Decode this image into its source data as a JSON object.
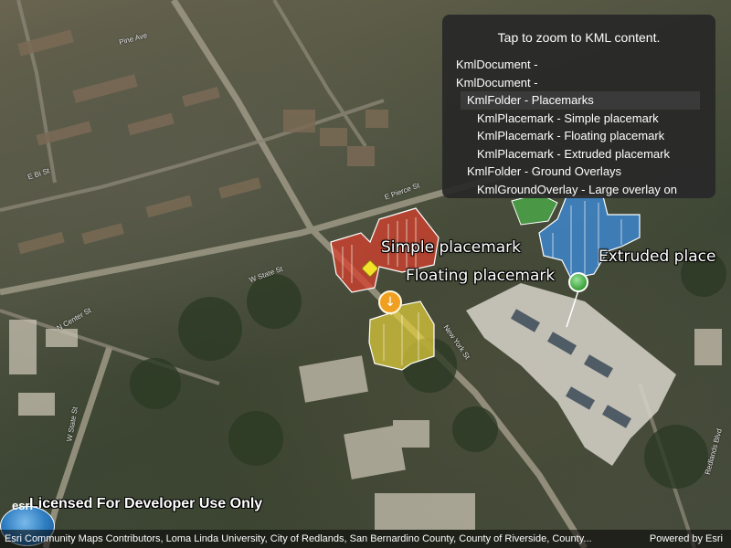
{
  "map": {
    "street_labels": {
      "pine_knot": "Pine Ave",
      "e_bi_st": "E Bi St",
      "w_state_st": "W State St",
      "w_state_st2": "W State St",
      "n_center_st": "N Center St",
      "e_pierce_st": "E Pierce St",
      "new_york_st": "New York St",
      "e_park_ave": "E Park Ave",
      "redlands_blvd": "Redlands Blvd"
    },
    "placemarks": {
      "simple": "Simple placemark",
      "floating": "Floating placemark",
      "extruded": "Extruded place"
    }
  },
  "kml_panel": {
    "hint": "Tap to zoom to KML content.",
    "items": [
      {
        "label": "KmlDocument -",
        "level": 0,
        "selected": false
      },
      {
        "label": "KmlDocument -",
        "level": 0,
        "selected": false
      },
      {
        "label": "KmlFolder - Placemarks",
        "level": 1,
        "selected": true
      },
      {
        "label": "KmlPlacemark - Simple placemark",
        "level": 2,
        "selected": false
      },
      {
        "label": "KmlPlacemark - Floating placemark",
        "level": 2,
        "selected": false
      },
      {
        "label": "KmlPlacemark - Extruded placemark",
        "level": 2,
        "selected": false
      },
      {
        "label": "KmlFolder - Ground Overlays",
        "level": 1,
        "selected": false
      },
      {
        "label": "KmlGroundOverlay - Large overlay on",
        "level": 2,
        "selected": false
      }
    ]
  },
  "watermark": "Licensed For Developer Use Only",
  "logo": {
    "text": "esri"
  },
  "attribution": {
    "credits": "Esri Community Maps Contributors, Loma Linda University, City of Redlands, San Bernardino County, County of Riverside, County...",
    "powered_by": "Powered by Esri"
  },
  "colors": {
    "panel_bg": "#282828",
    "simple_polygon": "#d7402d",
    "floating_polygon": "#e6d23c",
    "extruded_polygon": "#3c8ee0",
    "green_polygon": "#4bb84b"
  }
}
